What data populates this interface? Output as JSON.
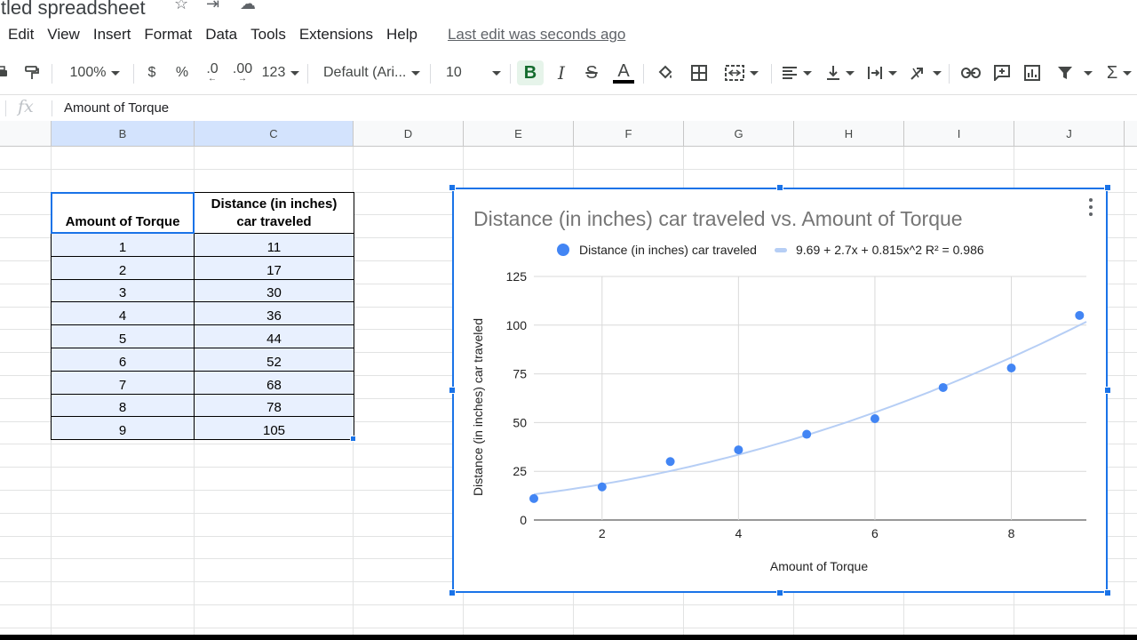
{
  "title": {
    "doc_name": "itled spreadsheet"
  },
  "menu": {
    "items": [
      "Edit",
      "View",
      "Insert",
      "Format",
      "Data",
      "Tools",
      "Extensions",
      "Help"
    ],
    "last_edit": "Last edit was seconds ago"
  },
  "toolbar": {
    "zoom": "100%",
    "currency": "$",
    "percent": "%",
    "decrease_decimal": ".0",
    "increase_decimal": ".00",
    "number_format": "123",
    "font": "Default (Ari...",
    "font_size": "10",
    "bold": "B",
    "italic": "I",
    "strikethrough": "S",
    "text_color": "A"
  },
  "formula_bar": {
    "fx": "fx",
    "value": "Amount of Torque"
  },
  "columns": [
    "B",
    "C",
    "D",
    "E",
    "F",
    "G",
    "H",
    "I",
    "J"
  ],
  "table": {
    "header_b": "Amount of Torque",
    "header_c_line1": "Distance (in inches)",
    "header_c_line2": "car traveled",
    "rows": [
      [
        "1",
        "11"
      ],
      [
        "2",
        "17"
      ],
      [
        "3",
        "30"
      ],
      [
        "4",
        "36"
      ],
      [
        "5",
        "44"
      ],
      [
        "6",
        "52"
      ],
      [
        "7",
        "68"
      ],
      [
        "8",
        "78"
      ],
      [
        "9",
        "105"
      ]
    ]
  },
  "chart_data": {
    "type": "scatter",
    "title": "Distance (in inches) car traveled vs. Amount of Torque",
    "xlabel": "Amount of Torque",
    "ylabel": "Distance (in inches) car traveled",
    "x": [
      1,
      2,
      3,
      4,
      5,
      6,
      7,
      8,
      9
    ],
    "series": [
      {
        "name": "Distance (in inches) car traveled",
        "values": [
          11,
          17,
          30,
          36,
          44,
          52,
          68,
          78,
          105
        ],
        "color": "#4285f4"
      }
    ],
    "trendline": {
      "label": "9.69 + 2.7x + 0.815x^2 R² = 0.986",
      "coefficients": [
        9.69,
        2.7,
        0.815
      ],
      "color": "#b6cef5"
    },
    "xlim": [
      1,
      9.1
    ],
    "ylim": [
      0,
      125
    ],
    "xticks": [
      2,
      4,
      6,
      8
    ],
    "yticks": [
      0,
      25,
      50,
      75,
      100,
      125
    ],
    "grid": true,
    "legend_position": "top"
  }
}
